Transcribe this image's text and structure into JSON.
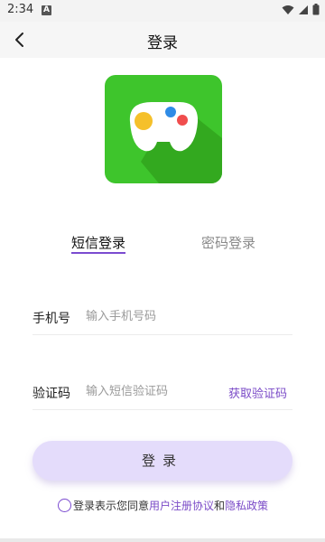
{
  "status_bar": {
    "time": "2:34",
    "notification_icon": "A"
  },
  "header": {
    "title": "登录"
  },
  "tabs": {
    "sms_label": "短信登录",
    "password_label": "密码登录"
  },
  "form": {
    "phone_label": "手机号",
    "phone_placeholder": "输入手机号码",
    "code_label": "验证码",
    "code_placeholder": "输入短信验证码",
    "get_code_label": "获取验证码"
  },
  "login_button_label": "登录",
  "agreement": {
    "prefix": "登录表示您同意",
    "user_agreement": "用户注册协议",
    "conjunction": "和",
    "privacy_policy": "隐私政策"
  },
  "colors": {
    "accent": "#7b4bd0",
    "logo_bg": "#3ec52c",
    "button_bg": "#e4dcfb"
  }
}
